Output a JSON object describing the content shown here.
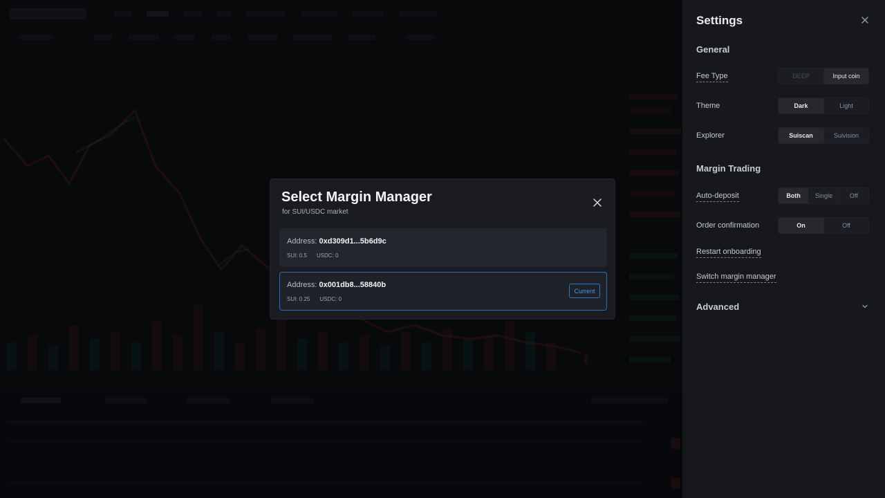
{
  "modal": {
    "title": "Select Margin Manager",
    "subtitle": "for SUI/USDC market",
    "managers": [
      {
        "address_label": "Address:",
        "address": "0xd309d1...5b6d9c",
        "sui": "SUI: 0.5",
        "usdc": "USDC: 0",
        "current": false
      },
      {
        "address_label": "Address:",
        "address": "0x001db8...58840b",
        "sui": "SUI: 0.25",
        "usdc": "USDC: 0",
        "current": true
      }
    ],
    "current_badge": "Current"
  },
  "settings": {
    "title": "Settings",
    "sections": {
      "general": "General",
      "margin": "Margin Trading",
      "advanced": "Advanced"
    },
    "fee_type": {
      "label": "Fee Type",
      "options": [
        "DEEP",
        "Input coin"
      ],
      "selected": "Input coin"
    },
    "theme": {
      "label": "Theme",
      "options": [
        "Dark",
        "Light"
      ],
      "selected": "Dark"
    },
    "explorer": {
      "label": "Explorer",
      "options": [
        "Suiscan",
        "Suivision"
      ],
      "selected": "Suiscan"
    },
    "auto_deposit": {
      "label": "Auto-deposit",
      "options": [
        "Both",
        "Single",
        "Off"
      ],
      "selected": "Both"
    },
    "order_confirmation": {
      "label": "Order confirmation",
      "options": [
        "On",
        "Off"
      ],
      "selected": "On"
    },
    "restart_onboarding": "Restart onboarding",
    "switch_margin_manager": "Switch margin manager"
  },
  "colors": {
    "accent_blue": "#2f78c4",
    "bull": "#1f8a6a",
    "bear": "#a8322f"
  }
}
